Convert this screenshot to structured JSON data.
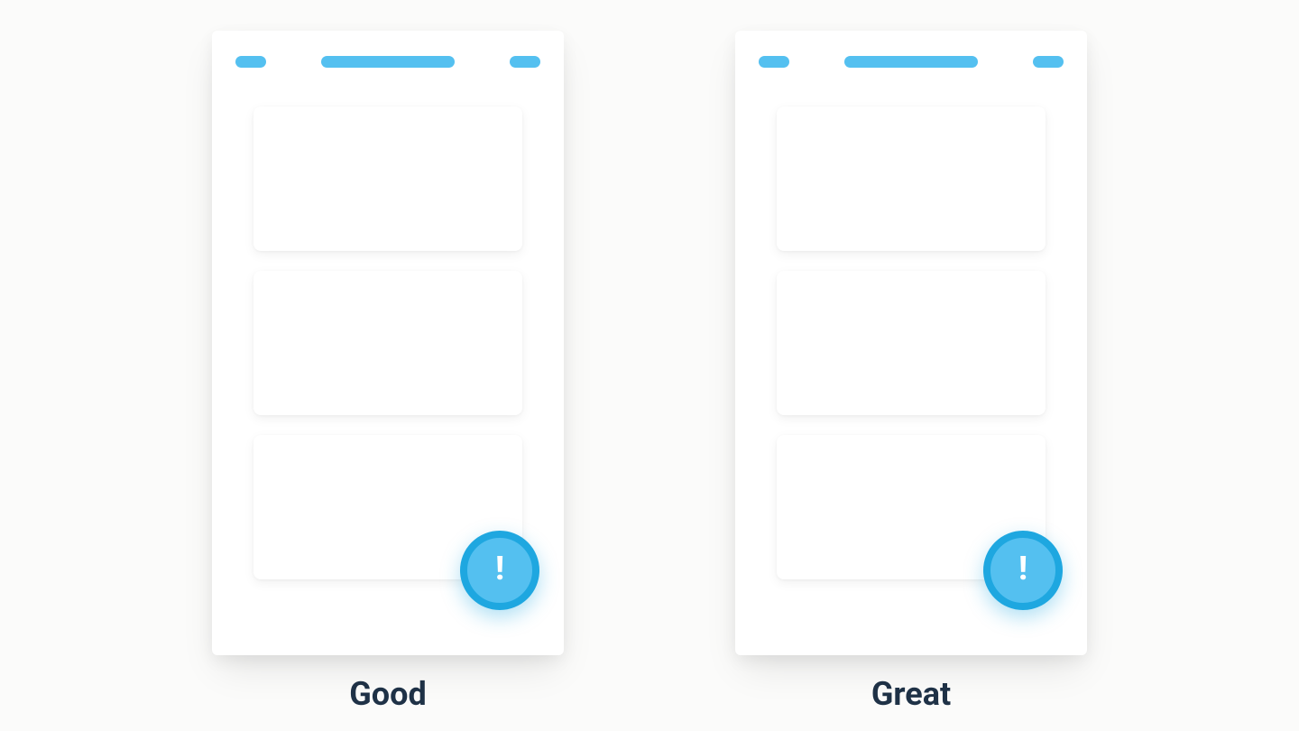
{
  "accent_color": "#54c0f0",
  "fab_ring_color": "#1ea7e0",
  "mockups": [
    {
      "caption": "Good",
      "fab_class": "fab-good"
    },
    {
      "caption": "Great",
      "fab_class": "fab-great"
    }
  ],
  "icons": {
    "fab": "!"
  }
}
